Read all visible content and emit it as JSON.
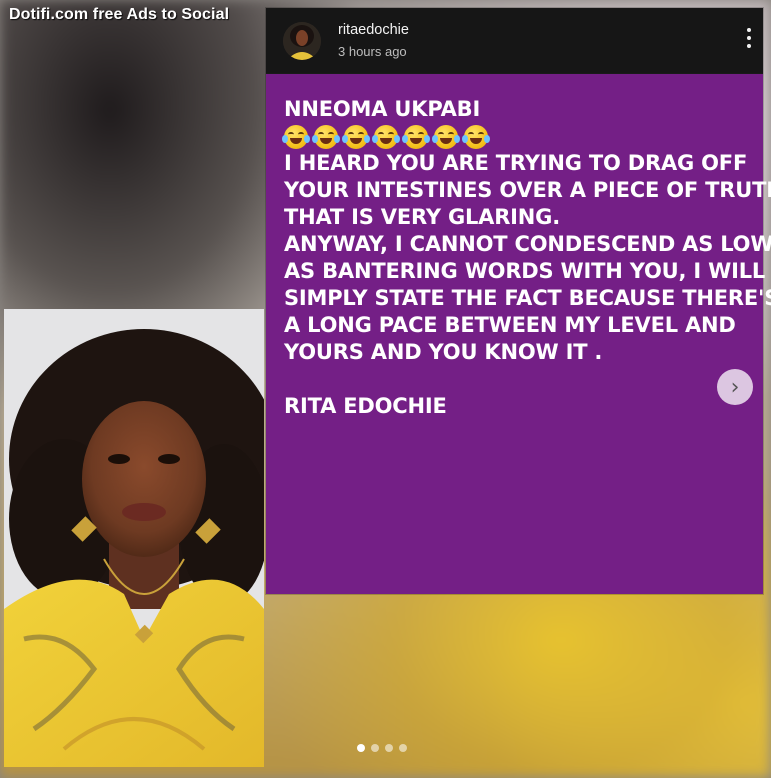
{
  "watermark": {
    "text": "Dotifi.com free Ads to Social"
  },
  "post": {
    "username": "ritaedochie",
    "timestamp": "3 hours ago",
    "more_icon": "more-vertical-icon",
    "body_color": "#741f86",
    "lines": {
      "heading": "NNEOMA UKPABI",
      "emoji_name": "face-with-tears-of-joy-icon",
      "emoji_count": 7,
      "l1": "I HEARD YOU ARE TRYING TO DRAG OFF",
      "l2": "YOUR INTESTINES OVER A PIECE OF TRUTH",
      "l3": "THAT IS VERY GLARING.",
      "l4": "ANYWAY, I CANNOT CONDESCEND AS LOW",
      "l5": "AS BANTERING WORDS WITH YOU, I WILL",
      "l6": "SIMPLY STATE THE FACT BECAUSE THERE'S",
      "l7": "A LONG PACE BETWEEN MY LEVEL AND",
      "l8": "YOURS AND YOU KNOW IT .",
      "signature": "RITA EDOCHIE"
    }
  },
  "carousel": {
    "next_icon": "chevron-right-icon",
    "next_glyph": "›",
    "dot_count": 4,
    "active_index": 0
  },
  "colors": {
    "accent_yellow": "#e8c32d",
    "header_bg": "#161616"
  }
}
